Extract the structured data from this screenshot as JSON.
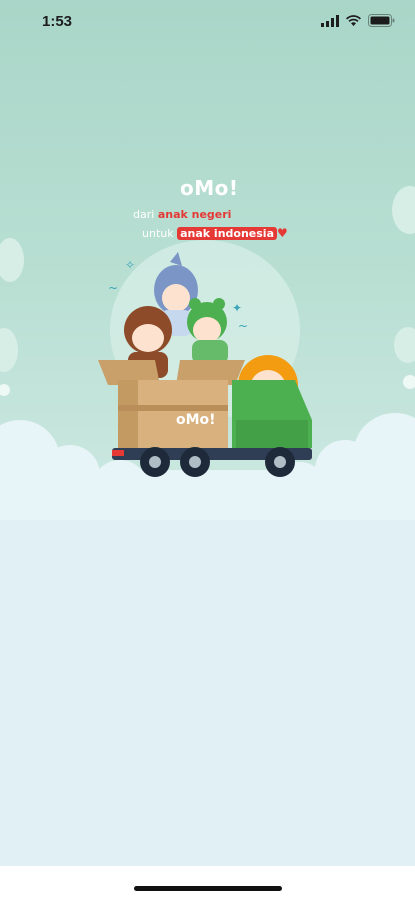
{
  "status_bar": {
    "time": "1:53",
    "icons": [
      "signal-icon",
      "wifi-icon",
      "battery-icon"
    ]
  },
  "splash": {
    "logo_text": "oMo!",
    "tagline_1_prefix": "dari",
    "tagline_1_highlight": "anak negeri",
    "tagline_2_prefix": "untuk",
    "tagline_2_highlight": "anak indonesia",
    "box_logo_text": "oMo!"
  },
  "colors": {
    "background_top": "#a9d6c8",
    "background_bottom": "#e0f0f4",
    "accent_red": "#e53935",
    "truck_green": "#4caf50"
  }
}
